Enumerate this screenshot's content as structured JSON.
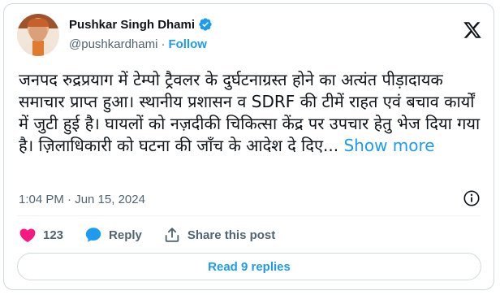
{
  "author": {
    "name": "Pushkar Singh Dhami",
    "handle": "@pushkardhami",
    "separator": "·",
    "follow_label": "Follow"
  },
  "tweet": {
    "text": "जनपद रुद्रप्रयाग में टेम्पो ट्रैवलर के दुर्घटनाग्रस्त होने का अत्यंत पीड़ादायक समाचार प्राप्त हुआ। स्थानीय प्रशासन व SDRF की टीमें राहत एवं बचाव कार्यों में जुटी हुई है। घायलों को नज़दीकी चिकित्सा केंद्र पर उपचार हेतु भेज दिया गया है। ज़िलाधिकारी को घटना की जाँच के आदेश दे दिए...",
    "show_more": "Show more",
    "timestamp": "1:04 PM · Jun 15, 2024"
  },
  "actions": {
    "like_count": "123",
    "reply_label": "Reply",
    "share_label": "Share this post"
  },
  "replies_button": "Read 9 replies",
  "icons": {
    "avatar": "avatar",
    "verified": "verified-badge-icon",
    "brand": "x-logo-icon",
    "info": "info-icon",
    "like": "heart-icon",
    "reply": "reply-bubble-icon",
    "share": "share-icon"
  },
  "colors": {
    "accent": "#1d9bf0",
    "like": "#f91880",
    "text": "#0f1419",
    "muted": "#536471",
    "border": "#cfd9de"
  }
}
